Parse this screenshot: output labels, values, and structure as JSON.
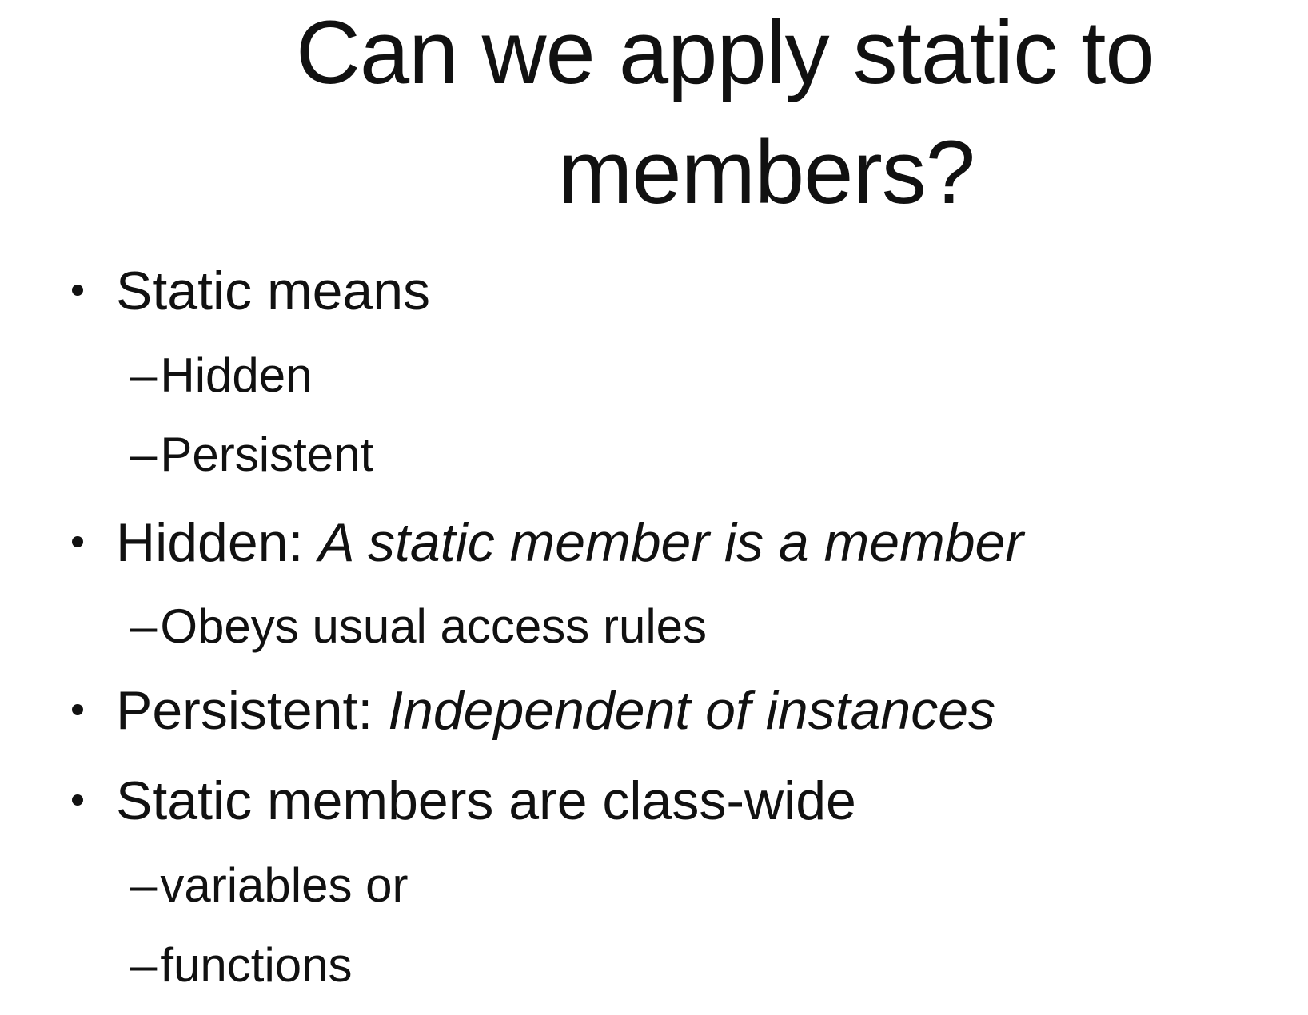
{
  "slide": {
    "title_line_1": "Can we apply static to",
    "title_line_2": "members?",
    "dash_glyph": "–",
    "bullets": [
      {
        "lead": "Static means",
        "subs": [
          "Hidden",
          "Persistent"
        ]
      },
      {
        "lead": "Hidden: ",
        "emphasis": "A static member is a member",
        "subs": [
          "Obeys usual access rules"
        ]
      },
      {
        "lead": "Persistent: ",
        "emphasis": "Independent of instances",
        "subs": []
      },
      {
        "lead": "Static members are class-wide",
        "subs": [
          "variables or",
          "functions"
        ]
      }
    ]
  }
}
